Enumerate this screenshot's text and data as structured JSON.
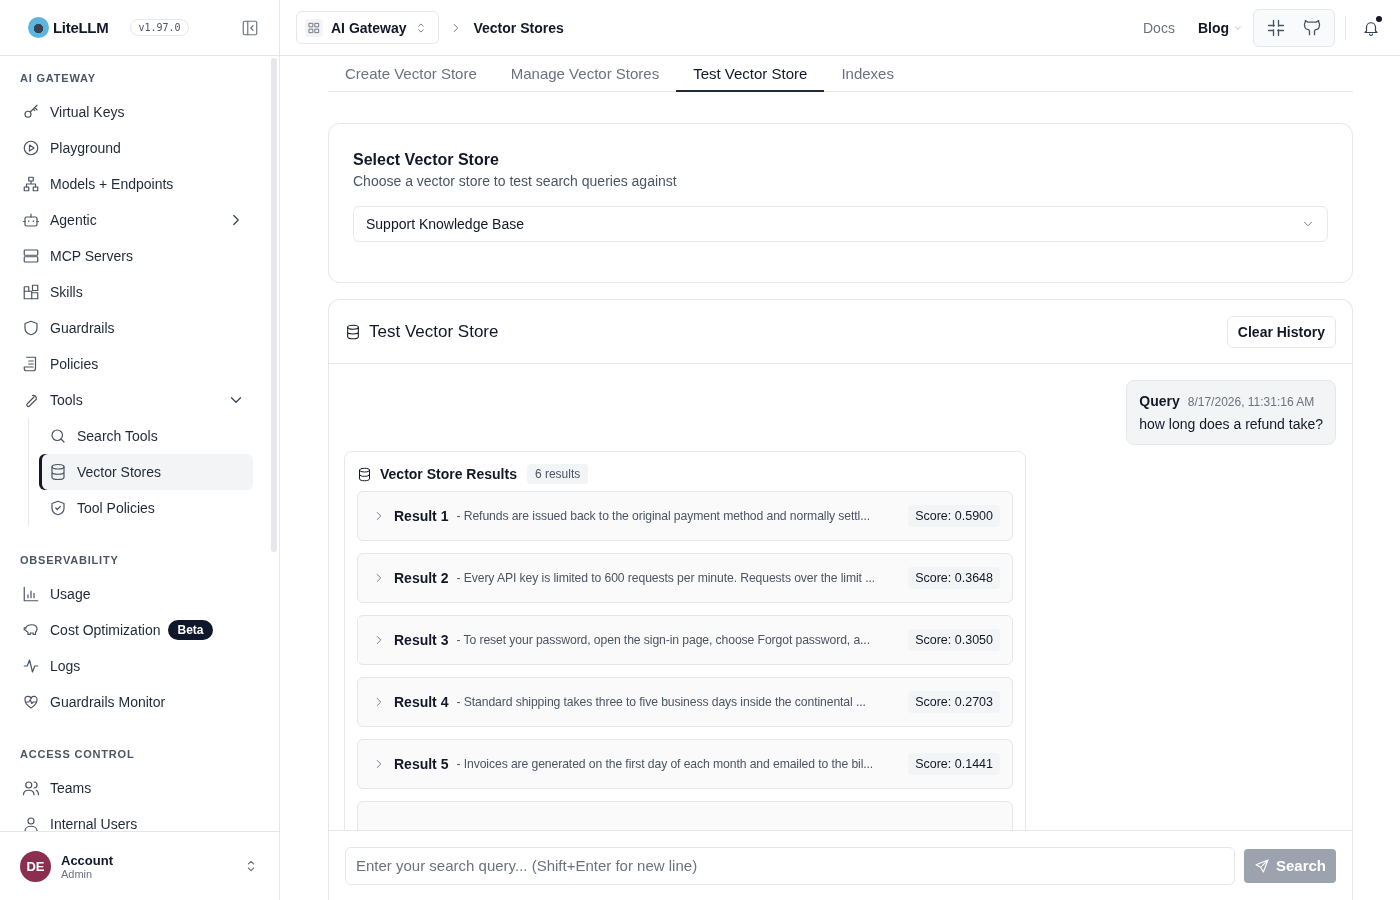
{
  "brand": {
    "name": "LiteLLM",
    "version": "v1.97.0"
  },
  "topbar": {
    "workspace": "AI Gateway",
    "breadcrumb": "Vector Stores",
    "links": [
      {
        "label": "Docs",
        "dropdown": false
      },
      {
        "label": "Blog",
        "dropdown": true
      }
    ],
    "notification_unread": true
  },
  "sidebar": {
    "sections": [
      {
        "title": "AI GATEWAY",
        "items": [
          {
            "label": "Virtual Keys",
            "selected": false
          },
          {
            "label": "Playground",
            "selected": false
          },
          {
            "label": "Models + Endpoints",
            "selected": false
          },
          {
            "label": "Agentic",
            "selected": false,
            "expanded": false
          },
          {
            "label": "MCP Servers",
            "selected": false
          },
          {
            "label": "Skills",
            "selected": false
          },
          {
            "label": "Guardrails",
            "selected": false
          },
          {
            "label": "Policies",
            "selected": false
          },
          {
            "label": "Tools",
            "selected": false,
            "expanded": true,
            "children": [
              {
                "label": "Search Tools",
                "selected": false
              },
              {
                "label": "Vector Stores",
                "selected": true
              },
              {
                "label": "Tool Policies",
                "selected": false
              }
            ]
          }
        ]
      },
      {
        "title": "OBSERVABILITY",
        "items": [
          {
            "label": "Usage",
            "selected": false
          },
          {
            "label": "Cost Optimization",
            "selected": false,
            "badge": "Beta"
          },
          {
            "label": "Logs",
            "selected": false
          },
          {
            "label": "Guardrails Monitor",
            "selected": false
          }
        ]
      },
      {
        "title": "ACCESS CONTROL",
        "items": [
          {
            "label": "Teams",
            "selected": false
          },
          {
            "label": "Internal Users",
            "selected": false
          }
        ]
      }
    ],
    "account": {
      "initials": "DE",
      "name": "Account",
      "role": "Admin"
    }
  },
  "tabs": [
    {
      "label": "Create Vector Store",
      "selected": false
    },
    {
      "label": "Manage Vector Stores",
      "selected": false
    },
    {
      "label": "Test Vector Store",
      "selected": true
    },
    {
      "label": "Indexes",
      "selected": false
    }
  ],
  "select_card": {
    "title": "Select Vector Store",
    "subtitle": "Choose a vector store to test search queries against",
    "value": "Support Knowledge Base"
  },
  "test_card": {
    "title": "Test Vector Store",
    "clear_button": "Clear History",
    "query": {
      "label": "Query",
      "time": "8/17/2026, 11:31:16 AM",
      "text": "how long does a refund take?"
    },
    "results": {
      "title": "Vector Store Results",
      "count": "6 results",
      "items": [
        {
          "label": "Result 1",
          "snippet": "- Refunds are issued back to the original payment method and normally settl...",
          "score": "Score: 0.5900",
          "expanded": false
        },
        {
          "label": "Result 2",
          "snippet": "- Every API key is limited to 600 requests per minute. Requests over the limit ...",
          "score": "Score: 0.3648",
          "expanded": false
        },
        {
          "label": "Result 3",
          "snippet": "- To reset your password, open the sign-in page, choose Forgot password, a...",
          "score": "Score: 0.3050",
          "expanded": false
        },
        {
          "label": "Result 4",
          "snippet": "- Standard shipping takes three to five business days inside the continental ...",
          "score": "Score: 0.2703",
          "expanded": false
        },
        {
          "label": "Result 5",
          "snippet": "- Invoices are generated on the first day of each month and emailed to the bil...",
          "score": "Score: 0.1441",
          "expanded": false
        }
      ]
    },
    "input": {
      "placeholder": "Enter your search query... (Shift+Enter for new line)"
    },
    "search_button": {
      "label": "Search",
      "disabled": true
    }
  }
}
